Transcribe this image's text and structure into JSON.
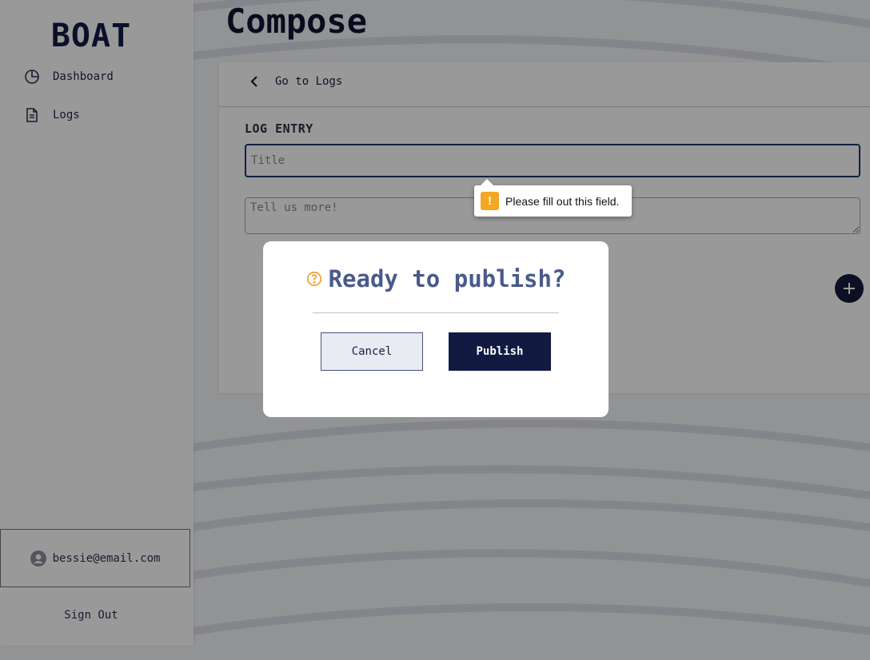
{
  "app": {
    "brand": "BOAT"
  },
  "sidebar": {
    "items": [
      {
        "label": "Dashboard",
        "icon": "pie-chart-icon"
      },
      {
        "label": "Logs",
        "icon": "document-icon"
      }
    ],
    "user_email": "bessie@email.com",
    "sign_out_label": "Sign Out"
  },
  "main": {
    "page_title": "Compose",
    "back_label": "Go to Logs",
    "section_label": "LOG ENTRY",
    "title_placeholder": "Title",
    "title_value": "",
    "body_placeholder": "Tell us more!",
    "body_value": ""
  },
  "tooltip": {
    "message": "Please fill out this field.",
    "icon": "warning-icon"
  },
  "modal": {
    "title": "Ready to publish?",
    "icon": "question-circle-icon",
    "cancel_label": "Cancel",
    "publish_label": "Publish"
  },
  "colors": {
    "brand_navy": "#121a42",
    "accent_orange": "#f5a623",
    "modal_title": "#4a5a8c"
  }
}
